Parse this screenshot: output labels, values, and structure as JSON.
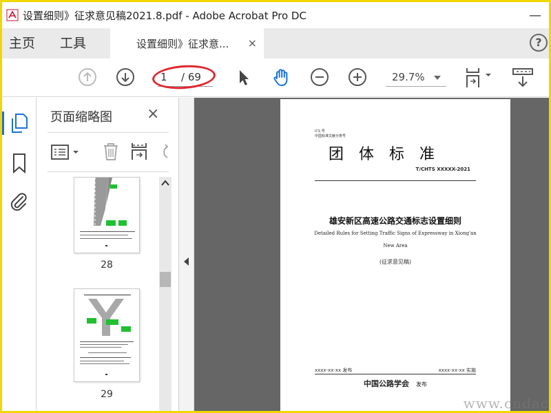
{
  "window": {
    "title": "设置细则》征求意见稿2021.8.pdf - Adobe Acrobat Pro DC",
    "minimize_glyph": "—"
  },
  "tabs": {
    "home": "主页",
    "tools": "工具",
    "document": "设置细则》征求意...",
    "close_glyph": "×",
    "help_glyph": "?"
  },
  "toolbar": {
    "page_current": "1",
    "page_total": "/ 69",
    "zoom": "29.7%",
    "icons": [
      "page-up-icon",
      "page-down-icon",
      "select-arrow-icon",
      "hand-icon",
      "zoom-out-icon",
      "zoom-in-icon",
      "fit-page-icon",
      "scroll-mode-icon"
    ]
  },
  "accent_color": "#1a73d6",
  "highlight_color": "#e0272e",
  "left_rail": {
    "icons": [
      "page-thumbnails-icon",
      "bookmark-icon",
      "attachment-icon"
    ]
  },
  "thumbnails_panel": {
    "title": "页面缩略图",
    "close_glyph": "×",
    "thumbnails": [
      {
        "label": "28"
      },
      {
        "label": "29"
      }
    ]
  },
  "document": {
    "ics": "ICS 号",
    "ccs": "中国标准文献分类号",
    "header": "团体标准",
    "number": "T/CHTS XXXXX-2021",
    "title_zh": "雄安新区高速公路交通标志设置细则",
    "title_en_line1": "Detailed Rules for Setting Traffic Signs of Expressway in Xiong'an",
    "title_en_line2": "New Area",
    "draft": "(征求意见稿)",
    "issue_date": "xxxx-xx-xx 发布",
    "implement_date": "xxxx-xx-xx 实施",
    "organization": "中国公路学会",
    "publish": "发布"
  },
  "watermark": "www.cndac"
}
